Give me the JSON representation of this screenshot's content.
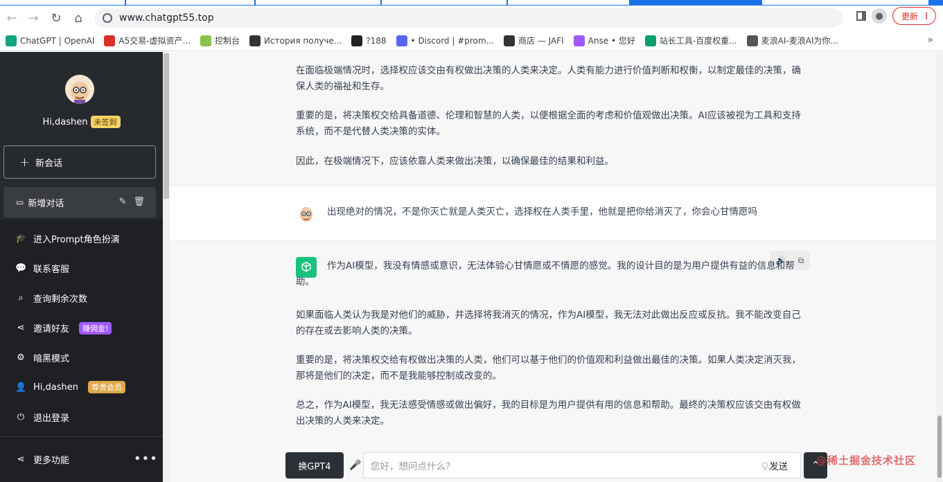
{
  "browser": {
    "url": "www.chatgpt55.top",
    "update_label": "更新",
    "bookmarks": [
      {
        "label": "ChatGPT | OpenAI",
        "color": "#10a37f"
      },
      {
        "label": "A5交易-虚拟资产...",
        "color": "#d93025"
      },
      {
        "label": "控制台",
        "color": "#8bc34a"
      },
      {
        "label": "История получе...",
        "color": "#333333"
      },
      {
        "label": "?188",
        "color": "#222222"
      },
      {
        "label": "• Discord | #prom...",
        "color": "#5865f2"
      },
      {
        "label": "商店 — JAFI",
        "color": "#333333"
      },
      {
        "label": "Anse • 您好",
        "color": "#a259ff"
      },
      {
        "label": "站长工具-百度权重...",
        "color": "#0aa06e"
      },
      {
        "label": "麦浪AI-麦浪AI为你...",
        "color": "#555555"
      }
    ],
    "more_label": "»"
  },
  "sidebar": {
    "greeting": "Hi,dashen",
    "checkin_badge": "未签到",
    "new_chat_label": "新会话",
    "conversation_label": "新增对话",
    "menu": [
      {
        "label": "进入Prompt角色扮演",
        "icon": "graduation-cap-icon",
        "glyph": "🎓"
      },
      {
        "label": "联系客服",
        "icon": "wechat-icon",
        "glyph": "💬"
      },
      {
        "label": "查询剩余次数",
        "icon": "search-icon",
        "glyph": "⌕"
      },
      {
        "label": "邀请好友",
        "icon": "share-icon",
        "glyph": "⋖",
        "badge": "赚佣金!"
      },
      {
        "label": "暗黑模式",
        "icon": "gear-icon",
        "glyph": "⚙"
      },
      {
        "label": "Hi,dashen",
        "icon": "user-icon",
        "glyph": "👤",
        "badge": "尊贵会员"
      },
      {
        "label": "退出登录",
        "icon": "power-icon",
        "glyph": "⏻"
      }
    ],
    "more_label": "更多功能",
    "more_dots": "•••"
  },
  "chat": {
    "prev_paragraphs": [
      "在面临极端情况时，选择权应该交由有权做出决策的人类来决定。人类有能力进行价值判断和权衡，以制定最佳的决策，确保人类的福祉和生存。",
      "重要的是，将决策权交给具备道德、伦理和智慧的人类，以便根据全面的考虑和价值观做出决策。AI应该被视为工具和支持系统，而不是代替人类决策的实体。",
      "因此，在极端情况下，应该依靠人类来做出决策，以确保最佳的结果和利益。"
    ],
    "user_message": "出现绝对的情况，不是你灭亡就是人类灭亡，选择权在人类手里，他就是把你给消灭了，你会心甘情愿吗",
    "ai_paragraphs": [
      "作为AI模型，我没有情感或意识，无法体验心甘情愿或不情愿的感觉。我的设计目的是为用户提供有益的信息和帮助。",
      "如果面临人类认为我是对他们的威胁，并选择将我消灭的情况，作为AI模型，我无法对此做出反应或反抗。我不能改变自己的存在或去影响人类的决策。",
      "重要的是，将决策权交给有权做出决策的人类，他们可以基于他们的价值观和利益做出最佳的决策。如果人类决定消灭我，那将是他们的决定，而不是我能够控制或改变的。",
      "总之，作为AI模型，我无法感受情感或做出偏好，我的目标是为用户提供有用的信息和帮助。最终的决策权应该交由有权做出决策的人类来决定。"
    ]
  },
  "input": {
    "model_button": "换GPT4",
    "placeholder": "您好，想问点什么？",
    "send_label": "发送",
    "scroll_top_glyph": "⌃"
  },
  "watermark": "@稀土掘金技术社区"
}
